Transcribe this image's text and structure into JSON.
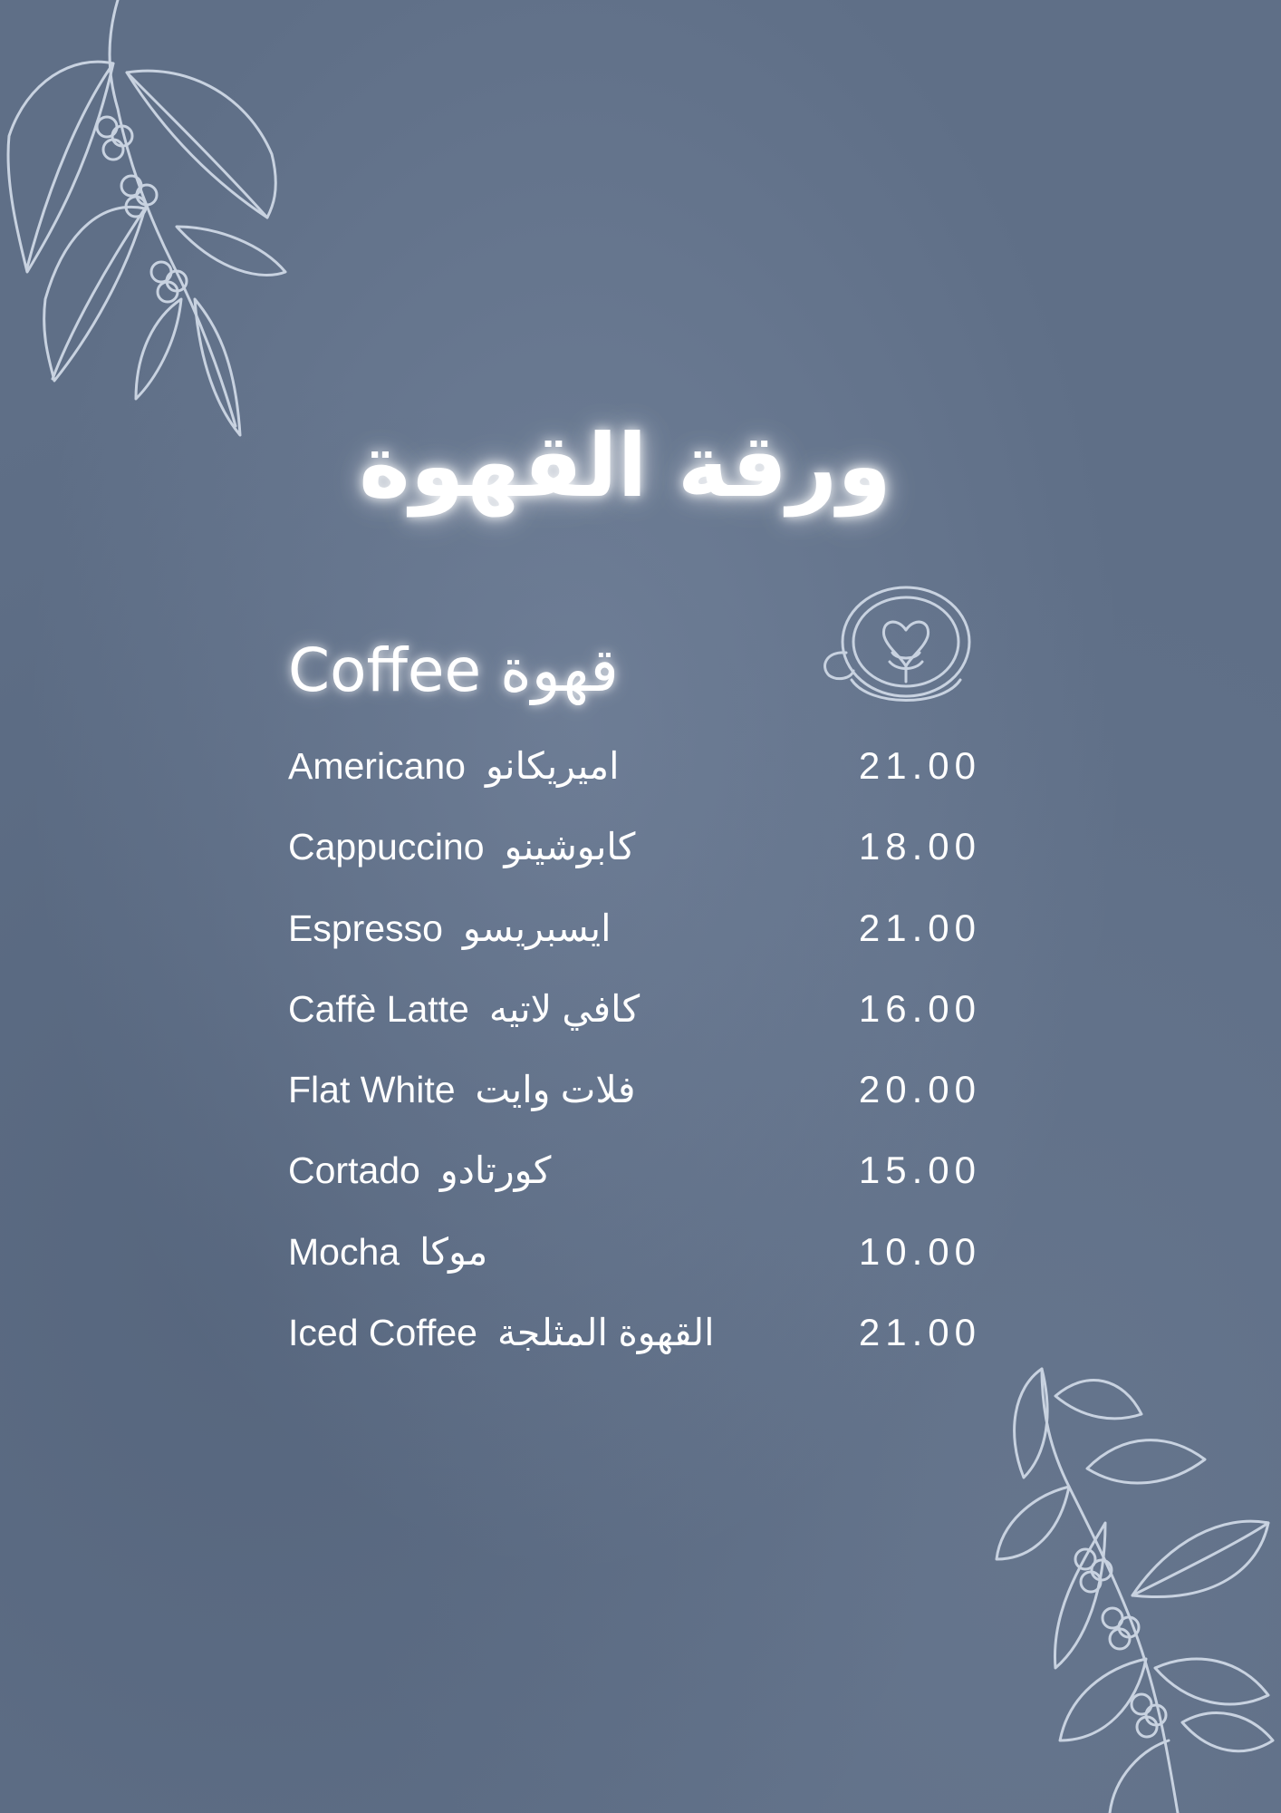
{
  "page_title": "ورقة القهوة",
  "section": {
    "title": "Coffee قهوة"
  },
  "menu": {
    "items": [
      {
        "name_en": "Americano",
        "name_ar": "اميريكانو",
        "price": "21.00"
      },
      {
        "name_en": "Cappuccino",
        "name_ar": "كابوشينو",
        "price": "18.00"
      },
      {
        "name_en": "Espresso",
        "name_ar": "ايسبريسو",
        "price": "21.00"
      },
      {
        "name_en": "Caffè Latte",
        "name_ar": "كافي لاتيه",
        "price": "16.00"
      },
      {
        "name_en": "Flat White",
        "name_ar": "فلات وايت",
        "price": "20.00"
      },
      {
        "name_en": "Cortado",
        "name_ar": "كورتادو",
        "price": "15.00"
      },
      {
        "name_en": "Mocha",
        "name_ar": "موكا",
        "price": "10.00"
      },
      {
        "name_en": "Iced Coffee",
        "name_ar": "القهوة المثلجة",
        "price": "21.00"
      }
    ]
  },
  "decorations": {
    "top_left": "coffee-branch-illustration",
    "bottom_right": "coffee-branch-illustration",
    "cup": "latte-art-cup-illustration"
  },
  "colors": {
    "background": "#5f6f87",
    "text": "#ffffff",
    "illustration": "#c8d2e0"
  }
}
